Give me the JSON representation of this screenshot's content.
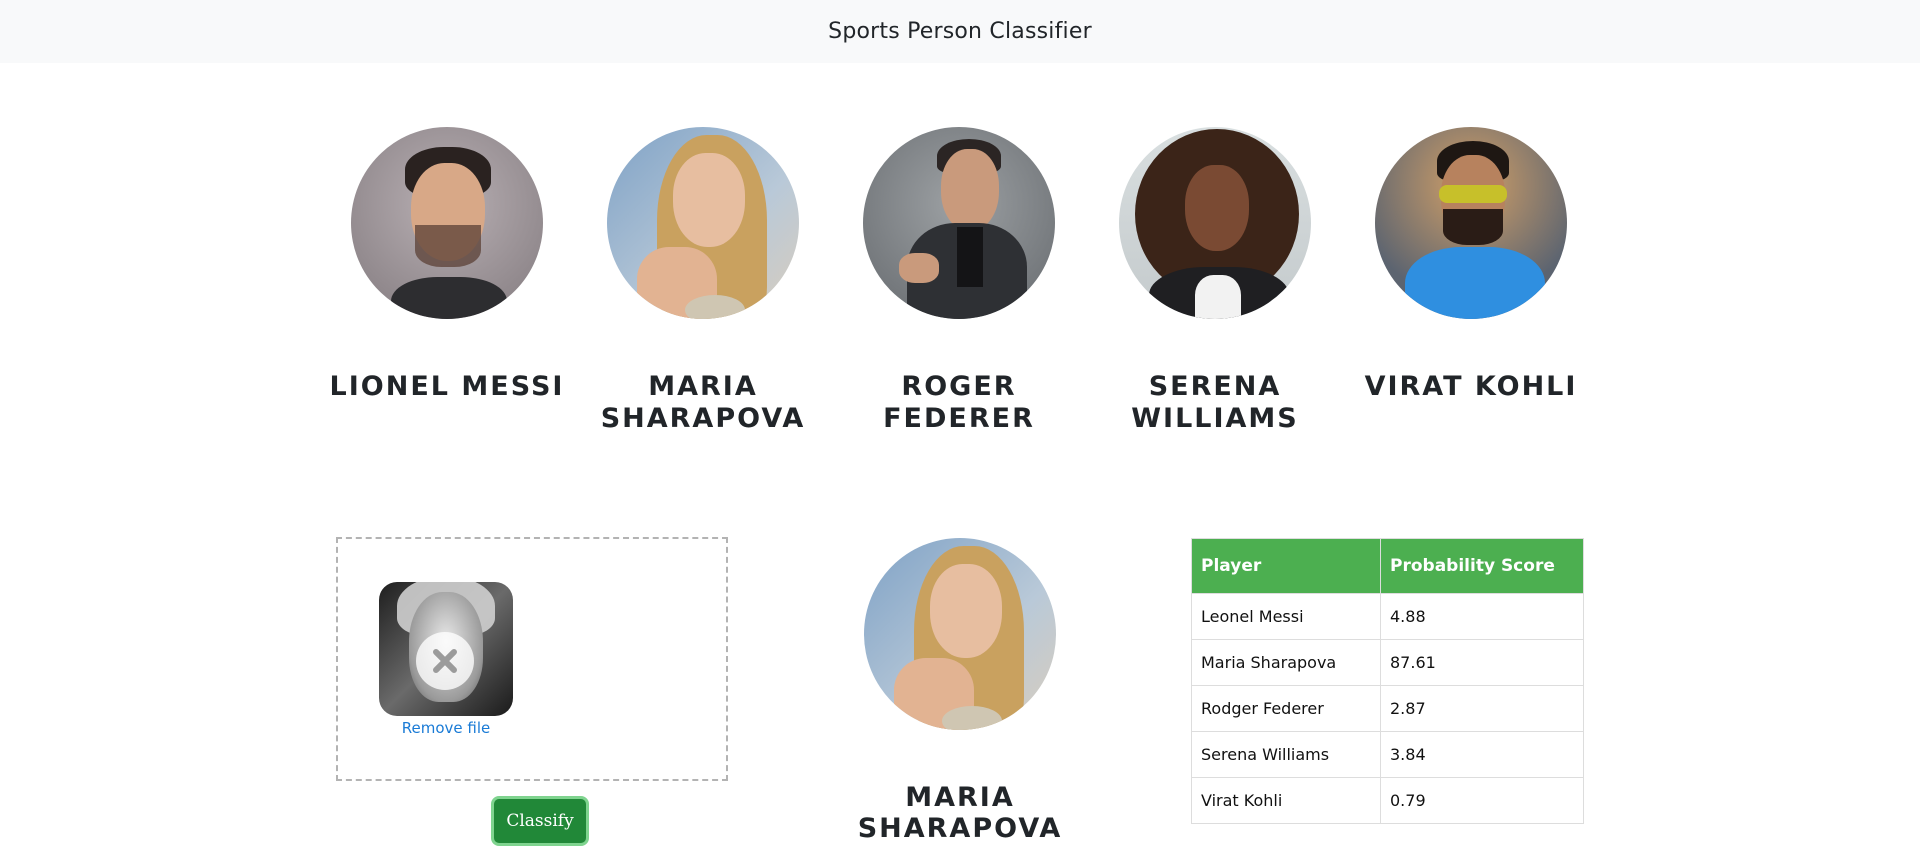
{
  "navbar": {
    "title": "Sports Person Classifier"
  },
  "players": [
    {
      "name": "LIONEL MESSI",
      "photo": "messi-portrait"
    },
    {
      "name": "MARIA SHARAPOVA",
      "photo": "sharapova-portrait"
    },
    {
      "name": "ROGER FEDERER",
      "photo": "federer-portrait"
    },
    {
      "name": "SERENA WILLIAMS",
      "photo": "serena-portrait"
    },
    {
      "name": "VIRAT KOHLI",
      "photo": "kohli-portrait"
    }
  ],
  "upload": {
    "remove_label": "Remove file",
    "icon": "close-icon"
  },
  "classify_label": "Classify",
  "result": {
    "name": "MARIA SHARAPOVA"
  },
  "table": {
    "headers": [
      "Player",
      "Probability Score"
    ],
    "rows": [
      [
        "Leonel Messi",
        "4.88"
      ],
      [
        "Maria Sharapova",
        "87.61"
      ],
      [
        "Rodger Federer",
        "2.87"
      ],
      [
        "Serena Williams",
        "3.84"
      ],
      [
        "Virat Kohli",
        "0.79"
      ]
    ]
  },
  "colors": {
    "navbar_bg": "#f8f9fa",
    "table_header_bg": "#4caf50",
    "button_bg": "#218838",
    "link": "#1a7bd6"
  }
}
